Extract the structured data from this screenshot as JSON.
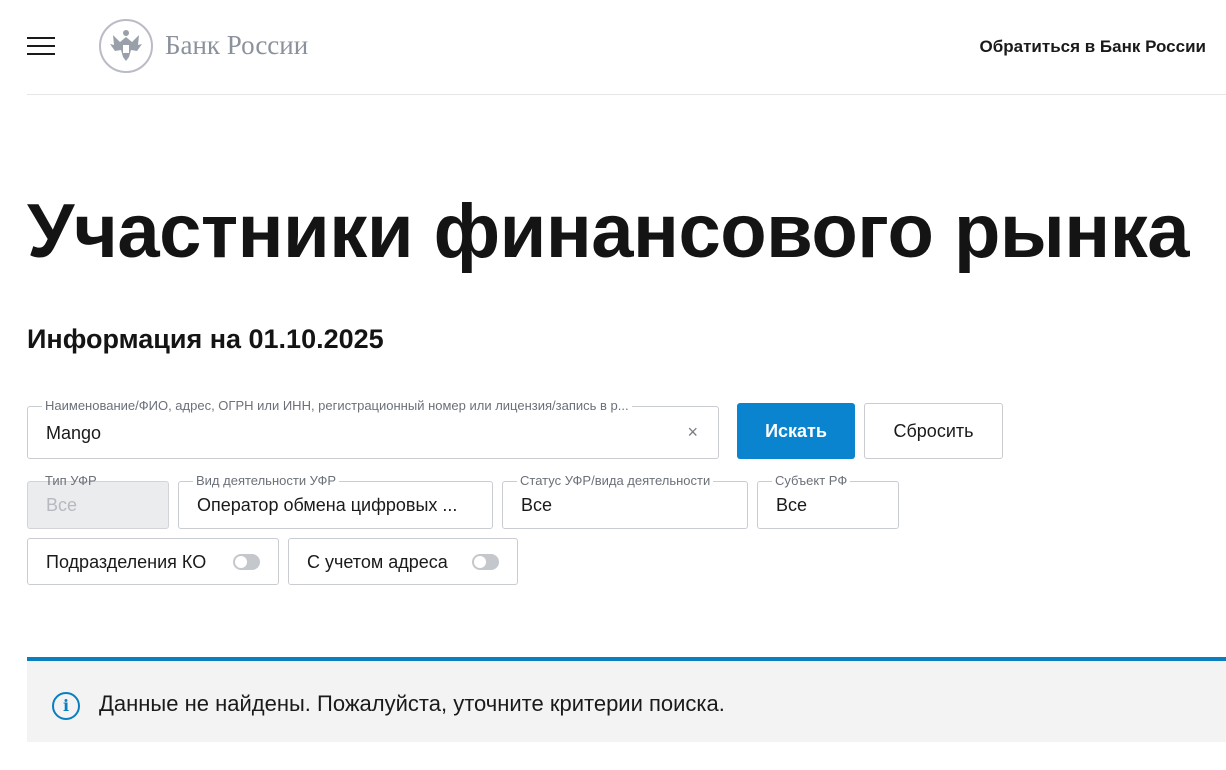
{
  "header": {
    "logo_text": "Банк России",
    "contact_link": "Обратиться в Банк России"
  },
  "page": {
    "title": "Участники финансового рынка",
    "info_date": "Информация на 01.10.2025"
  },
  "search": {
    "label": "Наименование/ФИО, адрес, ОГРН или ИНН, регистрационный номер или лицензия/запись в р...",
    "value": "Mango",
    "clear_glyph": "×",
    "search_button": "Искать",
    "reset_button": "Сбросить"
  },
  "filters": {
    "type": {
      "label": "Тип УФР",
      "value": "Все"
    },
    "activity": {
      "label": "Вид деятельности УФР",
      "value": "Оператор обмена цифровых ..."
    },
    "status": {
      "label": "Статус УФР/вида деятельности",
      "value": "Все"
    },
    "subject": {
      "label": "Субъект РФ",
      "value": "Все"
    }
  },
  "toggles": {
    "ko_divisions": {
      "label": "Подразделения КО",
      "on": false
    },
    "with_address": {
      "label": "С учетом адреса",
      "on": false
    }
  },
  "alert": {
    "icon_glyph": "i",
    "message": "Данные не найдены. Пожалуйста, уточните критерии поиска."
  },
  "colors": {
    "accent": "#0b84cf",
    "alert_border": "#0a7fc0",
    "alert_bg": "#f3f3f4"
  }
}
